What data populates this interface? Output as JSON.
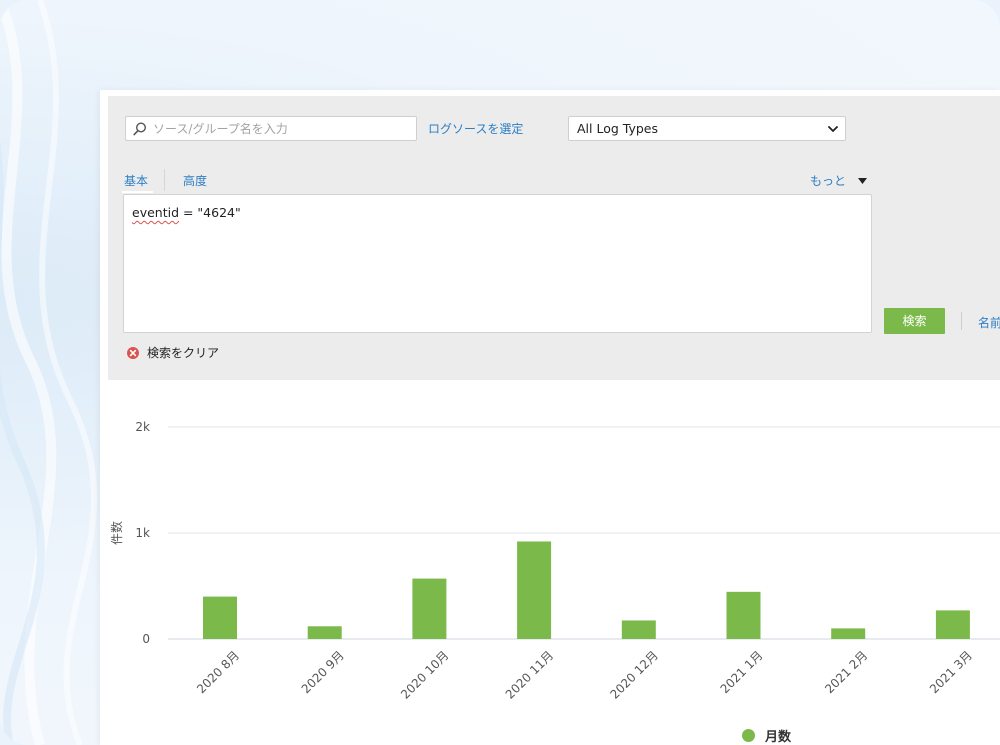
{
  "search": {
    "source_placeholder": "ソース/グループ名を入力",
    "select_source_link": "ログソースを選定",
    "log_type": "All Log Types",
    "tabs": [
      "基本",
      "高度"
    ],
    "more_label": "もっと",
    "query_field": "eventid",
    "query_rest": " = \"4624\"",
    "search_button": "検索",
    "name_link": "名前",
    "clear_label": "検索をクリア"
  },
  "colors": {
    "accent_green": "#7cb94b",
    "link_blue": "#2d7ec4",
    "clear_red": "#d9534f"
  },
  "chart_data": {
    "type": "bar",
    "categories": [
      "2020 8月",
      "2020 9月",
      "2020 10月",
      "2020 11月",
      "2020 12月",
      "2021 1月",
      "2021 2月",
      "2021 3月"
    ],
    "series": [
      {
        "name": "月数",
        "values": [
          400,
          120,
          570,
          920,
          175,
          445,
          100,
          270
        ]
      }
    ],
    "ylabel": "件数",
    "ylim": [
      0,
      2000
    ],
    "yticks": [
      {
        "value": 0,
        "label": "0"
      },
      {
        "value": 1000,
        "label": "1k"
      },
      {
        "value": 2000,
        "label": "2k"
      }
    ],
    "grid": true,
    "legend": "bottom",
    "bar_color": "#7cb94b"
  }
}
